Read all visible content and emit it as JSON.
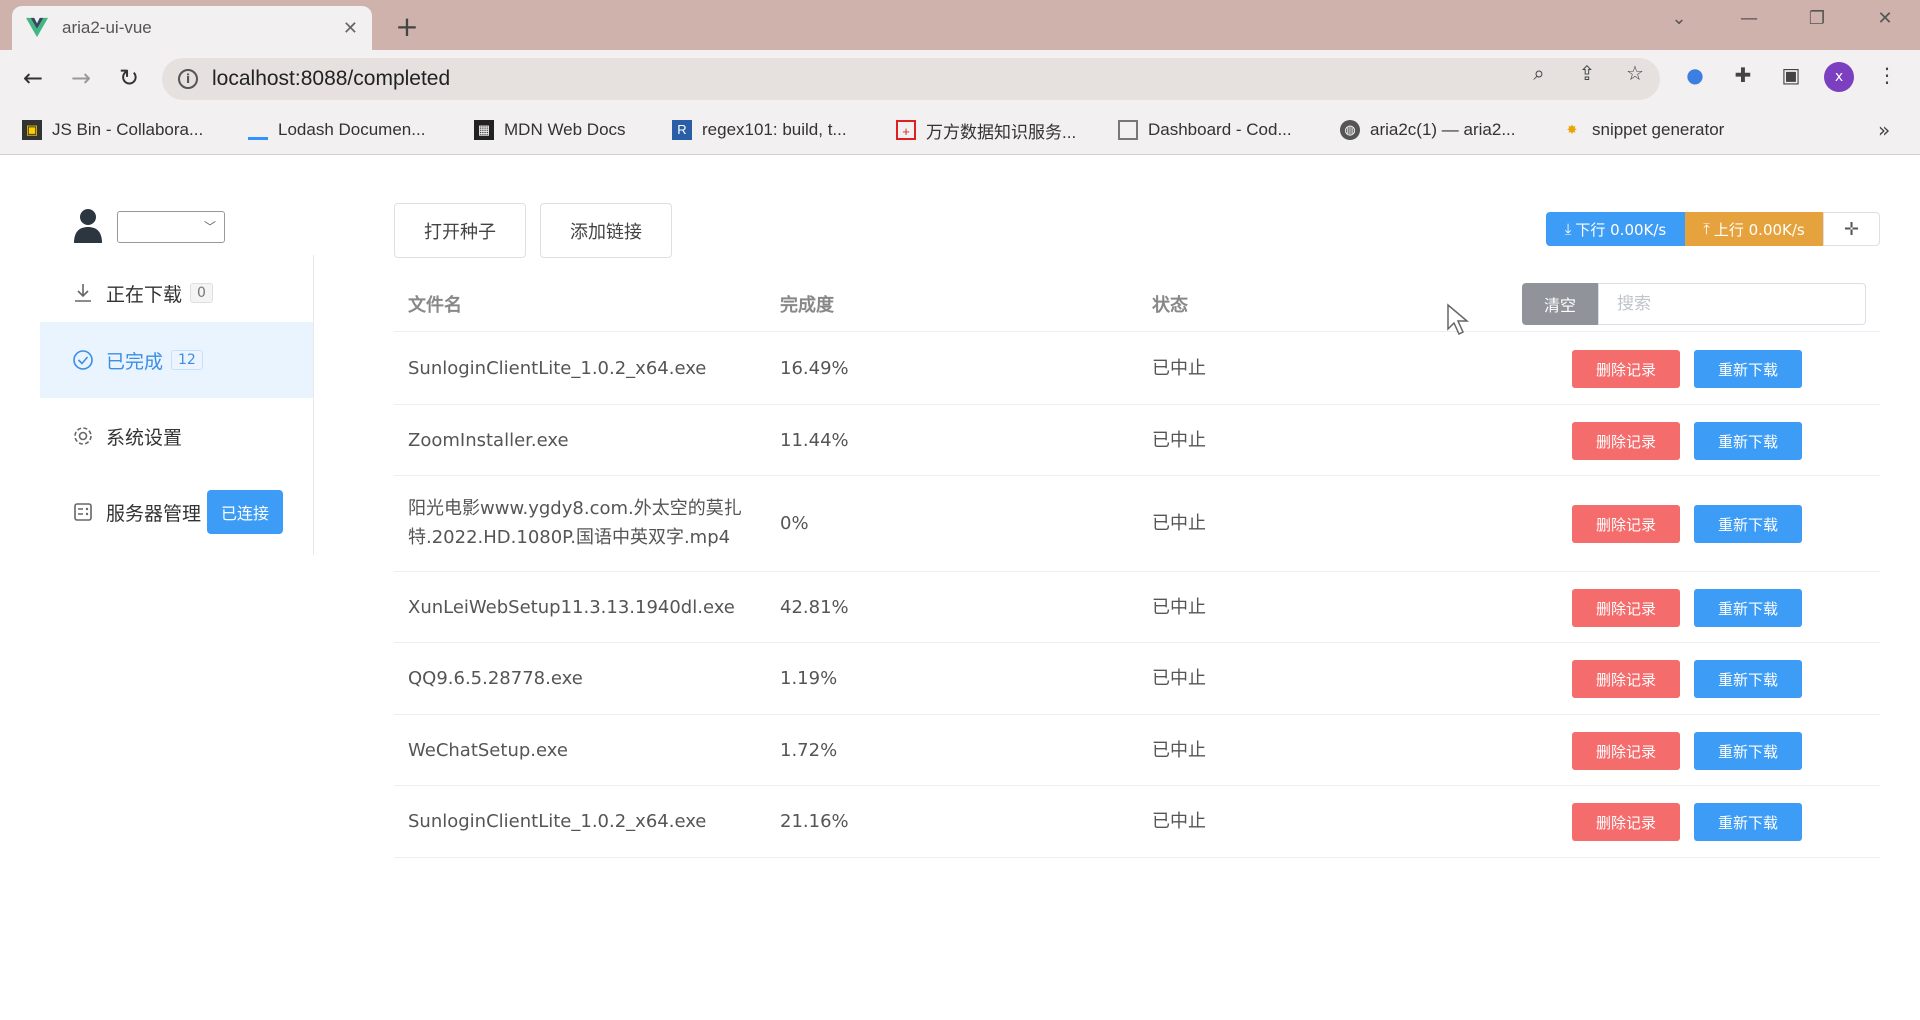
{
  "browser": {
    "tab_title": "aria2-ui-vue",
    "url": "localhost:8088/completed",
    "avatar_letter": "x",
    "bookmarks": [
      {
        "label": "JS Bin - Collabora...",
        "icon": "jsbin-icon"
      },
      {
        "label": "Lodash Documen...",
        "icon": "lodash-icon"
      },
      {
        "label": "MDN Web Docs",
        "icon": "mdn-icon"
      },
      {
        "label": "regex101: build, t...",
        "icon": "regex101-icon"
      },
      {
        "label": "万方数据知识服务...",
        "icon": "wanfang-icon"
      },
      {
        "label": "Dashboard - Cod...",
        "icon": "page-icon"
      },
      {
        "label": "aria2c(1) — aria2...",
        "icon": "globe-icon"
      },
      {
        "label": "snippet generator",
        "icon": "snippet-icon"
      }
    ]
  },
  "sidebar": {
    "items": [
      {
        "label": "正在下载",
        "count": "0"
      },
      {
        "label": "已完成",
        "count": "12"
      },
      {
        "label": "系统设置"
      },
      {
        "label": "服务器管理",
        "status": "已连接"
      }
    ]
  },
  "toolbar": {
    "open_torrent": "打开种子",
    "add_link": "添加链接",
    "download_speed": "下行 0.00K/s",
    "upload_speed": "上行 0.00K/s"
  },
  "table": {
    "headers": {
      "name": "文件名",
      "progress": "完成度",
      "status": "状态"
    },
    "clear_label": "清空",
    "search_placeholder": "搜索",
    "delete_label": "删除记录",
    "redownload_label": "重新下载",
    "rows": [
      {
        "name": "SunloginClientLite_1.0.2_x64.exe",
        "progress": "16.49%",
        "status": "已中止"
      },
      {
        "name": "ZoomInstaller.exe",
        "progress": "11.44%",
        "status": "已中止"
      },
      {
        "name": "阳光电影www.ygdy8.com.外太空的莫扎特.2022.HD.1080P.国语中英双字.mp4",
        "name_line1": "阳光电影www.ygdy8.com.外太空的莫扎",
        "name_line2": "特.2022.HD.1080P.国语中英双字.mp4",
        "progress": "0%",
        "status": "已中止"
      },
      {
        "name": "XunLeiWebSetup11.3.13.1940dl.exe",
        "progress": "42.81%",
        "status": "已中止"
      },
      {
        "name": "QQ9.6.5.28778.exe",
        "progress": "1.19%",
        "status": "已中止"
      },
      {
        "name": "WeChatSetup.exe",
        "progress": "1.72%",
        "status": "已中止"
      },
      {
        "name": "SunloginClientLite_1.0.2_x64.exe",
        "progress": "21.16%",
        "status": "已中止"
      }
    ]
  }
}
